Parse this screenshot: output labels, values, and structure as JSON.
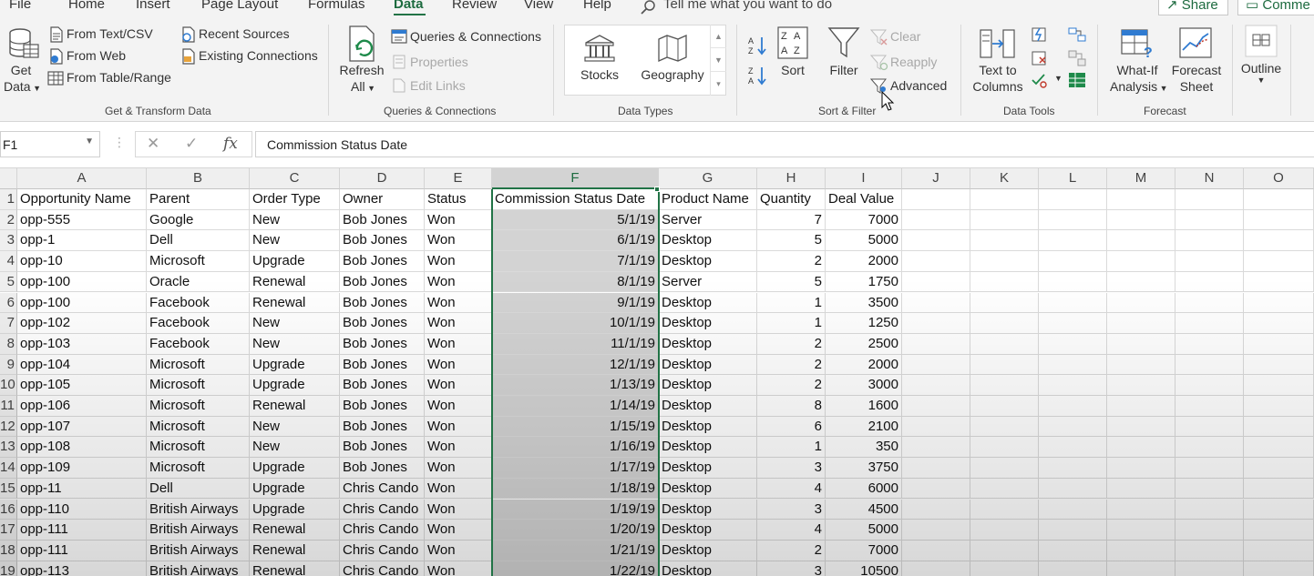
{
  "menu_tabs": [
    "File",
    "Home",
    "Insert",
    "Page Layout",
    "Formulas",
    "Data",
    "Review",
    "View",
    "Help"
  ],
  "active_tab": "Data",
  "tell_me": "Tell me what you want to do",
  "share_label": "Share",
  "comments_label": "Comme",
  "ribbon": {
    "get_transform": {
      "get_data_line1": "Get",
      "get_data_line2": "Data",
      "from_text_csv": "From Text/CSV",
      "from_web": "From Web",
      "from_table_range": "From Table/Range",
      "recent_sources": "Recent Sources",
      "existing_connections": "Existing Connections",
      "group_label": "Get & Transform Data"
    },
    "queries": {
      "refresh_line1": "Refresh",
      "refresh_line2": "All",
      "queries_connections": "Queries & Connections",
      "properties": "Properties",
      "edit_links": "Edit Links",
      "group_label": "Queries & Connections"
    },
    "data_types": {
      "stocks": "Stocks",
      "geography": "Geography",
      "group_label": "Data Types"
    },
    "sort_filter": {
      "sort": "Sort",
      "filter": "Filter",
      "clear": "Clear",
      "reapply": "Reapply",
      "advanced": "Advanced",
      "group_label": "Sort & Filter"
    },
    "data_tools": {
      "text_to_columns_line1": "Text to",
      "text_to_columns_line2": "Columns",
      "group_label": "Data Tools"
    },
    "forecast": {
      "what_if_line1": "What-If",
      "what_if_line2": "Analysis",
      "forecast_sheet_line1": "Forecast",
      "forecast_sheet_line2": "Sheet",
      "group_label": "Forecast"
    },
    "outline": {
      "label": "Outline"
    }
  },
  "formula_bar": {
    "name_box": "F1",
    "fx": "fx",
    "content": "Commission Status Date"
  },
  "grid": {
    "columns": [
      "A",
      "B",
      "C",
      "D",
      "E",
      "F",
      "G",
      "H",
      "I",
      "J",
      "K",
      "L",
      "M",
      "N",
      "O"
    ],
    "selected_column": "F",
    "row_numbers": [
      "1",
      "2",
      "3",
      "4",
      "5",
      "6",
      "7",
      "8",
      "9",
      "10",
      "11",
      "12",
      "13",
      "14",
      "15",
      "16",
      "17",
      "18",
      "19"
    ],
    "header": [
      "Opportunity Name",
      "Parent",
      "Order Type",
      "Owner",
      "Status",
      "Commission Status Date",
      "Product Name",
      "Quantity",
      "Deal Value"
    ],
    "rows": [
      [
        "opp-555",
        "Google",
        "New",
        "Bob Jones",
        "Won",
        "5/1/19",
        "Server",
        "7",
        "7000"
      ],
      [
        "opp-1",
        "Dell",
        "New",
        "Bob Jones",
        "Won",
        "6/1/19",
        "Desktop",
        "5",
        "5000"
      ],
      [
        "opp-10",
        "Microsoft",
        "Upgrade",
        "Bob Jones",
        "Won",
        "7/1/19",
        "Desktop",
        "2",
        "2000"
      ],
      [
        "opp-100",
        "Oracle",
        "Renewal",
        "Bob Jones",
        "Won",
        "8/1/19",
        "Server",
        "5",
        "1750"
      ],
      [
        "opp-100",
        "Facebook",
        "Renewal",
        "Bob Jones",
        "Won",
        "9/1/19",
        "Desktop",
        "1",
        "3500"
      ],
      [
        "opp-102",
        "Facebook",
        "New",
        "Bob Jones",
        "Won",
        "10/1/19",
        "Desktop",
        "1",
        "1250"
      ],
      [
        "opp-103",
        "Facebook",
        "New",
        "Bob Jones",
        "Won",
        "11/1/19",
        "Desktop",
        "2",
        "2500"
      ],
      [
        "opp-104",
        "Microsoft",
        "Upgrade",
        "Bob Jones",
        "Won",
        "12/1/19",
        "Desktop",
        "2",
        "2000"
      ],
      [
        "opp-105",
        "Microsoft",
        "Upgrade",
        "Bob Jones",
        "Won",
        "1/13/19",
        "Desktop",
        "2",
        "3000"
      ],
      [
        "opp-106",
        "Microsoft",
        "Renewal",
        "Bob Jones",
        "Won",
        "1/14/19",
        "Desktop",
        "8",
        "1600"
      ],
      [
        "opp-107",
        "Microsoft",
        "New",
        "Bob Jones",
        "Won",
        "1/15/19",
        "Desktop",
        "6",
        "2100"
      ],
      [
        "opp-108",
        "Microsoft",
        "New",
        "Bob Jones",
        "Won",
        "1/16/19",
        "Desktop",
        "1",
        "350"
      ],
      [
        "opp-109",
        "Microsoft",
        "Upgrade",
        "Bob Jones",
        "Won",
        "1/17/19",
        "Desktop",
        "3",
        "3750"
      ],
      [
        "opp-11",
        "Dell",
        "Upgrade",
        "Chris Cando",
        "Won",
        "1/18/19",
        "Desktop",
        "4",
        "6000"
      ],
      [
        "opp-110",
        "British Airways",
        "Upgrade",
        "Chris Cando",
        "Won",
        "1/19/19",
        "Desktop",
        "3",
        "4500"
      ],
      [
        "opp-111",
        "British Airways",
        "Renewal",
        "Chris Cando",
        "Won",
        "1/20/19",
        "Desktop",
        "4",
        "5000"
      ],
      [
        "opp-111",
        "British Airways",
        "Renewal",
        "Chris Cando",
        "Won",
        "1/21/19",
        "Desktop",
        "2",
        "7000"
      ],
      [
        "opp-113",
        "British Airways",
        "Renewal",
        "Chris Cando",
        "Won",
        "1/22/19",
        "Desktop",
        "3",
        "10500"
      ]
    ]
  },
  "colors": {
    "accent": "#217346",
    "selection": "#d3d3d3"
  }
}
